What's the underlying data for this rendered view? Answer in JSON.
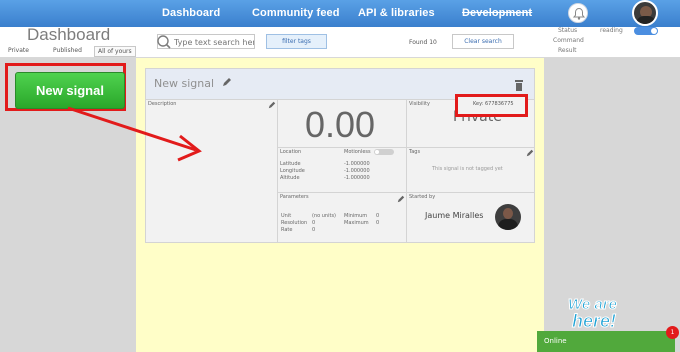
{
  "nav": {
    "items": [
      {
        "label": "Dashboard"
      },
      {
        "label": "Community feed"
      },
      {
        "label": "API & libraries"
      },
      {
        "label": "Development"
      }
    ]
  },
  "header": {
    "title": "Dashboard",
    "filters": [
      "Private",
      "Published",
      "All of yours"
    ],
    "search_placeholder": "Type text search here",
    "filter_tags_label": "filter tags",
    "found_text": "Found 10",
    "clear_search_label": "Clear search",
    "status": {
      "status_label": "Status",
      "status_value": "reading",
      "command_label": "Command",
      "result_label": "Result"
    }
  },
  "sidebar": {
    "new_signal_label": "New signal"
  },
  "card": {
    "title": "New signal",
    "description_label": "Description",
    "value": "0.00",
    "visibility_label": "Visibility",
    "visibility_value": "Private",
    "key_text": "Key: 677836775",
    "location": {
      "label": "Location",
      "motionless_label": "Motionless",
      "rows": [
        {
          "k": "Latitude",
          "v": "-1.000000"
        },
        {
          "k": "Longitude",
          "v": "-1.000000"
        },
        {
          "k": "Altitude",
          "v": "-1.000000"
        }
      ]
    },
    "tags": {
      "label": "Tags",
      "empty_text": "This signal is not tagged yet"
    },
    "parameters": {
      "label": "Parameters",
      "unit_label": "Unit",
      "unit_value": "(no units)",
      "resolution_label": "Resolution",
      "resolution_value": "0",
      "rate_label": "Rate",
      "rate_value": "0",
      "minimum_label": "Minimum",
      "minimum_value": "0",
      "maximum_label": "Maximum",
      "maximum_value": "0"
    },
    "started_by": {
      "label": "Started by",
      "name": "Jaume Miralles"
    }
  },
  "widget": {
    "we_are_here": "We are here!",
    "online_label": "Online",
    "badge_count": "1"
  },
  "colors": {
    "nav": "#3a7fcd",
    "highlight": "#e21b1b",
    "green_button": "#2aa72a",
    "main_bg": "#fffec8",
    "sidebar_bg": "#d7d7d7"
  },
  "icons": [
    "search-icon",
    "bell-icon",
    "pencil-icon",
    "trash-icon"
  ]
}
